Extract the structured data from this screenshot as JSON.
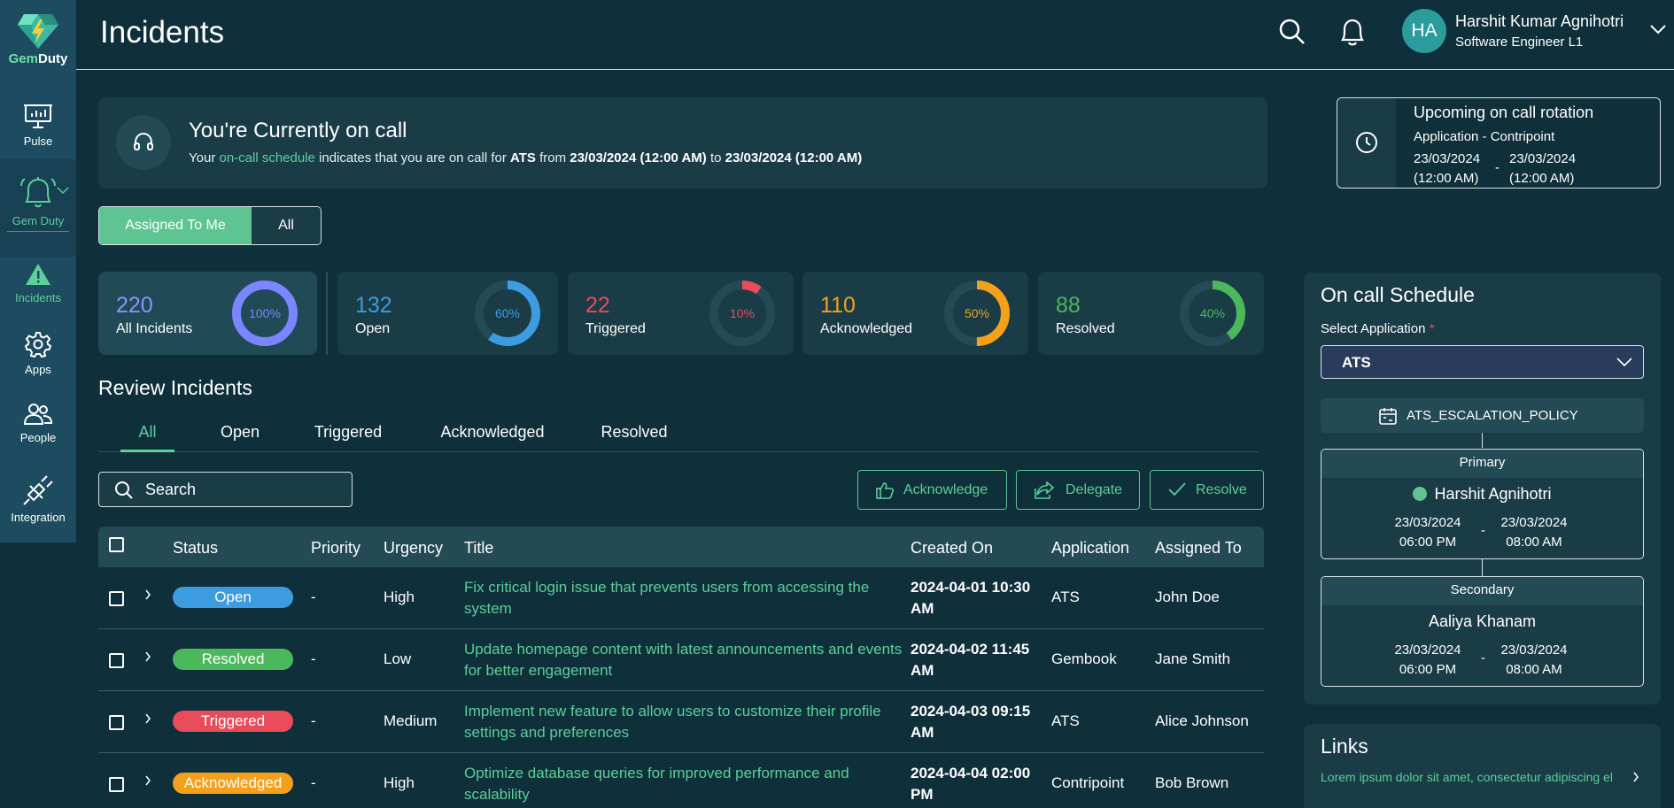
{
  "sidebar": {
    "brand_prefix": "Gem",
    "brand_suffix": "Duty",
    "items": [
      {
        "label": "Pulse",
        "icon": "presentation-chart-icon"
      },
      {
        "label": "Gem Duty",
        "icon": "bell-icon"
      },
      {
        "label": "Incidents",
        "icon": "warning-triangle-icon"
      },
      {
        "label": "Apps",
        "icon": "gear-icon"
      },
      {
        "label": "People",
        "icon": "people-icon"
      },
      {
        "label": "Integration",
        "icon": "plug-icon"
      }
    ]
  },
  "header": {
    "title": "Incidents",
    "user": {
      "initials": "HA",
      "name": "Harshit Kumar Agnihotri",
      "role": "Software Engineer L1"
    }
  },
  "oncall": {
    "title": "You're Currently on call",
    "text_pre": "Your ",
    "link": "on-call schedule",
    "text_mid": " indicates that you are on call for ",
    "app": "ATS",
    "from_word": " from ",
    "from": "23/03/2024 (12:00 AM)",
    "to_word": " to ",
    "to": "23/03/2024 (12:00 AM)"
  },
  "rotation": {
    "title": "Upcoming on call rotation",
    "application": "Application - Contripoint",
    "start_date": "23/03/2024",
    "start_time": "(12:00 AM)",
    "separator": "-",
    "end_date": "23/03/2024",
    "end_time": "(12:00 AM)"
  },
  "filter_toggle": {
    "assigned": "Assigned To Me",
    "all": "All"
  },
  "stats": [
    {
      "value": "220",
      "label": "All Incidents",
      "percent": 100,
      "percent_label": "100%",
      "color": "#7b85ff"
    },
    {
      "value": "132",
      "label": "Open",
      "percent": 60,
      "percent_label": "60%",
      "color": "#3d9be0"
    },
    {
      "value": "22",
      "label": "Triggered",
      "percent": 10,
      "percent_label": "10%",
      "color": "#e84b5a"
    },
    {
      "value": "110",
      "label": "Acknowledged",
      "percent": 50,
      "percent_label": "50%",
      "color": "#f5a01a"
    },
    {
      "value": "88",
      "label": "Resolved",
      "percent": 40,
      "percent_label": "40%",
      "color": "#4cb85c"
    }
  ],
  "review": {
    "title": "Review Incidents",
    "tabs": [
      "All",
      "Open",
      "Triggered",
      "Acknowledged",
      "Resolved"
    ],
    "search_placeholder": "Search",
    "actions": {
      "acknowledge": "Acknowledge",
      "delegate": "Delegate",
      "resolve": "Resolve"
    }
  },
  "table": {
    "headers": [
      "Status",
      "Priority",
      "Urgency",
      "Title",
      "Created On",
      "Application",
      "Assigned To"
    ],
    "rows": [
      {
        "status": "Open",
        "status_color": "#3d9be0",
        "priority": "-",
        "urgency": "High",
        "title": "Fix critical login issue that prevents users from accessing the system",
        "created": "2024-04-01 10:30 AM",
        "application": "ATS",
        "assigned": "John Doe"
      },
      {
        "status": "Resolved",
        "status_color": "#4cb85c",
        "priority": "-",
        "urgency": "Low",
        "title": "Update homepage content with latest announcements and events for better engagement",
        "created": "2024-04-02 11:45 AM",
        "application": "Gembook",
        "assigned": "Jane Smith"
      },
      {
        "status": "Triggered",
        "status_color": "#e84b5a",
        "priority": "-",
        "urgency": "Medium",
        "title": "Implement new feature to allow users to customize their profile settings and preferences",
        "created": "2024-04-03 09:15 AM",
        "application": "ATS",
        "assigned": "Alice Johnson"
      },
      {
        "status": "Acknowledged",
        "status_color": "#f5a01a",
        "priority": "-",
        "urgency": "High",
        "title": "Optimize database queries for improved performance and scalability",
        "created": "2024-04-04 02:00 PM",
        "application": "Contripoint",
        "assigned": "Bob Brown"
      }
    ]
  },
  "schedule": {
    "title": "On call Schedule",
    "select_label": "Select Application",
    "required_mark": "*",
    "selected_app": "ATS",
    "policy": "ATS_ESCALATION_POLICY",
    "primary": {
      "heading": "Primary",
      "name": "Harshit Agnihotri",
      "start_date": "23/03/2024",
      "start_time": "06:00 PM",
      "separator": "-",
      "end_date": "23/03/2024",
      "end_time": "08:00 AM"
    },
    "secondary": {
      "heading": "Secondary",
      "name": "Aaliya Khanam",
      "start_date": "23/03/2024",
      "start_time": "06:00 PM",
      "separator": "-",
      "end_date": "23/03/2024",
      "end_time": "08:00 AM"
    }
  },
  "links": {
    "title": "Links",
    "item": "Lorem ipsum dolor sit amet, consectetur adipiscing el"
  }
}
